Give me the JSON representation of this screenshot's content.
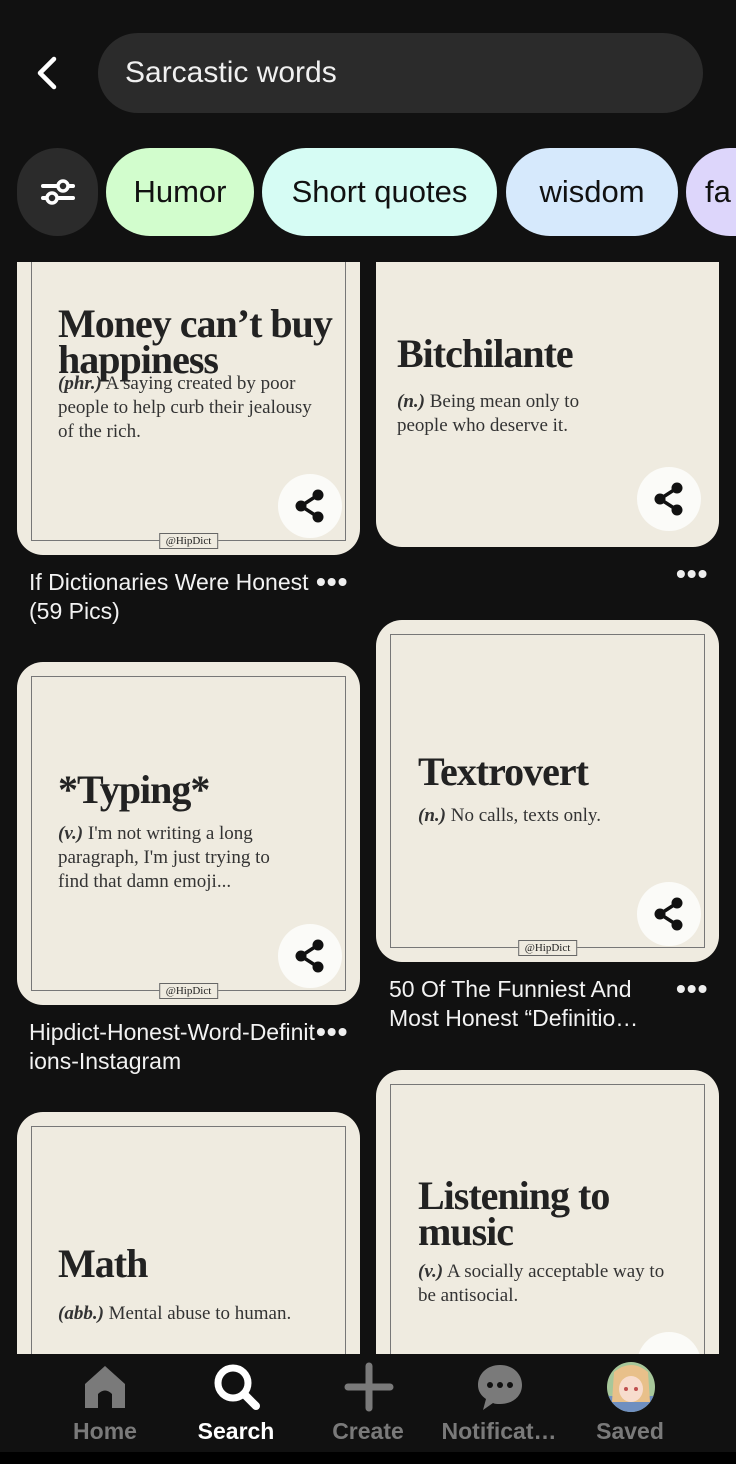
{
  "header": {
    "search_value": "Sarcastic words",
    "back_icon": "chevron-left-icon"
  },
  "chips": [
    {
      "label": "Humor",
      "color": "#d2fdcd"
    },
    {
      "label": "Short quotes",
      "color": "#d6fcf4"
    },
    {
      "label": "wisdom",
      "color": "#d6e9fc"
    },
    {
      "label": "fa",
      "color": "#ddd6fb"
    }
  ],
  "pins": [
    {
      "title": "Money can’t buy happiness",
      "pos": "(phr.)",
      "def": "A saying created by poor people to help curb their jealousy of the rich.",
      "tag": "@HipDict",
      "caption": "If Dictionaries Were Honest (59 Pics)"
    },
    {
      "title": "Bitchilante",
      "pos": "(n.)",
      "def": "Being mean only to people who deserve it.",
      "caption": ""
    },
    {
      "title": "*Typing*",
      "pos": "(v.)",
      "def": "I'm not writing a long paragraph, I'm just trying to find that damn emoji...",
      "tag": "@HipDict",
      "caption": "Hipdict-Honest-Word-Definitions-Instagram"
    },
    {
      "title": "Textrovert",
      "pos": "(n.)",
      "def": "No calls, texts only.",
      "tag": "@HipDict",
      "caption": "50 Of The Funniest And Most Honest “Definitio…"
    },
    {
      "title": "Math",
      "pos": "(abb.)",
      "def": "Mental abuse to human."
    },
    {
      "title": "Listening to music",
      "pos": "(v.)",
      "def": "A socially acceptable way to be antisocial."
    }
  ],
  "more_label": "•••",
  "nav": [
    {
      "label": "Home",
      "icon": "home-icon"
    },
    {
      "label": "Search",
      "icon": "search-icon",
      "active": true
    },
    {
      "label": "Create",
      "icon": "plus-icon"
    },
    {
      "label": "Notificat…",
      "icon": "chat-bubble-icon"
    },
    {
      "label": "Saved",
      "icon": "avatar"
    }
  ]
}
